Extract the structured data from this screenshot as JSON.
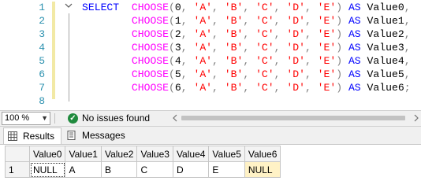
{
  "editor": {
    "line_numbers": [
      "1",
      "2",
      "3",
      "4",
      "5",
      "6",
      "7",
      "8"
    ],
    "select_keyword": "SELECT",
    "fn_name": "CHOOSE",
    "as_keyword": "AS",
    "letters": [
      "'A'",
      "'B'",
      "'C'",
      "'D'",
      "'E'"
    ],
    "lines": [
      {
        "index": "0",
        "alias": "Value0",
        "end": ","
      },
      {
        "index": "1",
        "alias": "Value1",
        "end": ","
      },
      {
        "index": "2",
        "alias": "Value2",
        "end": ","
      },
      {
        "index": "3",
        "alias": "Value3",
        "end": ","
      },
      {
        "index": "4",
        "alias": "Value4",
        "end": ","
      },
      {
        "index": "5",
        "alias": "Value5",
        "end": ","
      },
      {
        "index": "6",
        "alias": "Value6",
        "end": ";"
      }
    ]
  },
  "status": {
    "zoom": "100 %",
    "issues": "No issues found"
  },
  "results": {
    "tabs": {
      "results": "Results",
      "messages": "Messages"
    },
    "columns": [
      "Value0",
      "Value1",
      "Value2",
      "Value3",
      "Value4",
      "Value5",
      "Value6"
    ],
    "rows": [
      {
        "num": "1",
        "cells": [
          "NULL",
          "A",
          "B",
          "C",
          "D",
          "E",
          "NULL"
        ]
      }
    ]
  },
  "colors": {
    "keyword": "#0000ff",
    "function": "#ff00ff",
    "string": "#ff0000",
    "line_number": "#2b91af",
    "null_highlight": "#fff2c6",
    "success": "#1f8a3d"
  },
  "icons": {
    "fold": "collapse-chevron-icon",
    "check": "check-circle-icon",
    "results_tab": "grid-icon",
    "messages_tab": "messages-icon",
    "zoom_dropdown": "chevron-down-icon"
  }
}
